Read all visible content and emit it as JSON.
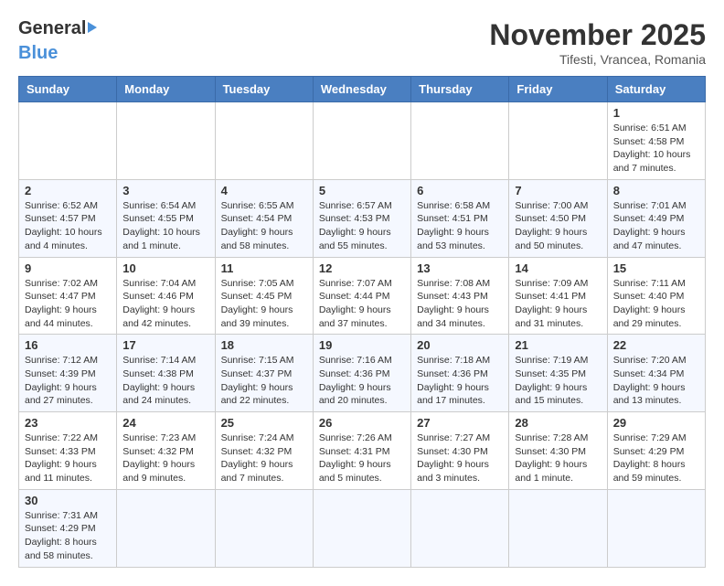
{
  "header": {
    "logo_general": "General",
    "logo_blue": "Blue",
    "month": "November 2025",
    "location": "Tifesti, Vrancea, Romania"
  },
  "weekdays": [
    "Sunday",
    "Monday",
    "Tuesday",
    "Wednesday",
    "Thursday",
    "Friday",
    "Saturday"
  ],
  "weeks": [
    [
      {
        "day": "",
        "info": ""
      },
      {
        "day": "",
        "info": ""
      },
      {
        "day": "",
        "info": ""
      },
      {
        "day": "",
        "info": ""
      },
      {
        "day": "",
        "info": ""
      },
      {
        "day": "",
        "info": ""
      },
      {
        "day": "1",
        "info": "Sunrise: 6:51 AM\nSunset: 4:58 PM\nDaylight: 10 hours and 7 minutes."
      }
    ],
    [
      {
        "day": "2",
        "info": "Sunrise: 6:52 AM\nSunset: 4:57 PM\nDaylight: 10 hours and 4 minutes."
      },
      {
        "day": "3",
        "info": "Sunrise: 6:54 AM\nSunset: 4:55 PM\nDaylight: 10 hours and 1 minute."
      },
      {
        "day": "4",
        "info": "Sunrise: 6:55 AM\nSunset: 4:54 PM\nDaylight: 9 hours and 58 minutes."
      },
      {
        "day": "5",
        "info": "Sunrise: 6:57 AM\nSunset: 4:53 PM\nDaylight: 9 hours and 55 minutes."
      },
      {
        "day": "6",
        "info": "Sunrise: 6:58 AM\nSunset: 4:51 PM\nDaylight: 9 hours and 53 minutes."
      },
      {
        "day": "7",
        "info": "Sunrise: 7:00 AM\nSunset: 4:50 PM\nDaylight: 9 hours and 50 minutes."
      },
      {
        "day": "8",
        "info": "Sunrise: 7:01 AM\nSunset: 4:49 PM\nDaylight: 9 hours and 47 minutes."
      }
    ],
    [
      {
        "day": "9",
        "info": "Sunrise: 7:02 AM\nSunset: 4:47 PM\nDaylight: 9 hours and 44 minutes."
      },
      {
        "day": "10",
        "info": "Sunrise: 7:04 AM\nSunset: 4:46 PM\nDaylight: 9 hours and 42 minutes."
      },
      {
        "day": "11",
        "info": "Sunrise: 7:05 AM\nSunset: 4:45 PM\nDaylight: 9 hours and 39 minutes."
      },
      {
        "day": "12",
        "info": "Sunrise: 7:07 AM\nSunset: 4:44 PM\nDaylight: 9 hours and 37 minutes."
      },
      {
        "day": "13",
        "info": "Sunrise: 7:08 AM\nSunset: 4:43 PM\nDaylight: 9 hours and 34 minutes."
      },
      {
        "day": "14",
        "info": "Sunrise: 7:09 AM\nSunset: 4:41 PM\nDaylight: 9 hours and 31 minutes."
      },
      {
        "day": "15",
        "info": "Sunrise: 7:11 AM\nSunset: 4:40 PM\nDaylight: 9 hours and 29 minutes."
      }
    ],
    [
      {
        "day": "16",
        "info": "Sunrise: 7:12 AM\nSunset: 4:39 PM\nDaylight: 9 hours and 27 minutes."
      },
      {
        "day": "17",
        "info": "Sunrise: 7:14 AM\nSunset: 4:38 PM\nDaylight: 9 hours and 24 minutes."
      },
      {
        "day": "18",
        "info": "Sunrise: 7:15 AM\nSunset: 4:37 PM\nDaylight: 9 hours and 22 minutes."
      },
      {
        "day": "19",
        "info": "Sunrise: 7:16 AM\nSunset: 4:36 PM\nDaylight: 9 hours and 20 minutes."
      },
      {
        "day": "20",
        "info": "Sunrise: 7:18 AM\nSunset: 4:36 PM\nDaylight: 9 hours and 17 minutes."
      },
      {
        "day": "21",
        "info": "Sunrise: 7:19 AM\nSunset: 4:35 PM\nDaylight: 9 hours and 15 minutes."
      },
      {
        "day": "22",
        "info": "Sunrise: 7:20 AM\nSunset: 4:34 PM\nDaylight: 9 hours and 13 minutes."
      }
    ],
    [
      {
        "day": "23",
        "info": "Sunrise: 7:22 AM\nSunset: 4:33 PM\nDaylight: 9 hours and 11 minutes."
      },
      {
        "day": "24",
        "info": "Sunrise: 7:23 AM\nSunset: 4:32 PM\nDaylight: 9 hours and 9 minutes."
      },
      {
        "day": "25",
        "info": "Sunrise: 7:24 AM\nSunset: 4:32 PM\nDaylight: 9 hours and 7 minutes."
      },
      {
        "day": "26",
        "info": "Sunrise: 7:26 AM\nSunset: 4:31 PM\nDaylight: 9 hours and 5 minutes."
      },
      {
        "day": "27",
        "info": "Sunrise: 7:27 AM\nSunset: 4:30 PM\nDaylight: 9 hours and 3 minutes."
      },
      {
        "day": "28",
        "info": "Sunrise: 7:28 AM\nSunset: 4:30 PM\nDaylight: 9 hours and 1 minute."
      },
      {
        "day": "29",
        "info": "Sunrise: 7:29 AM\nSunset: 4:29 PM\nDaylight: 8 hours and 59 minutes."
      }
    ],
    [
      {
        "day": "30",
        "info": "Sunrise: 7:31 AM\nSunset: 4:29 PM\nDaylight: 8 hours and 58 minutes."
      },
      {
        "day": "",
        "info": ""
      },
      {
        "day": "",
        "info": ""
      },
      {
        "day": "",
        "info": ""
      },
      {
        "day": "",
        "info": ""
      },
      {
        "day": "",
        "info": ""
      },
      {
        "day": "",
        "info": ""
      }
    ]
  ]
}
